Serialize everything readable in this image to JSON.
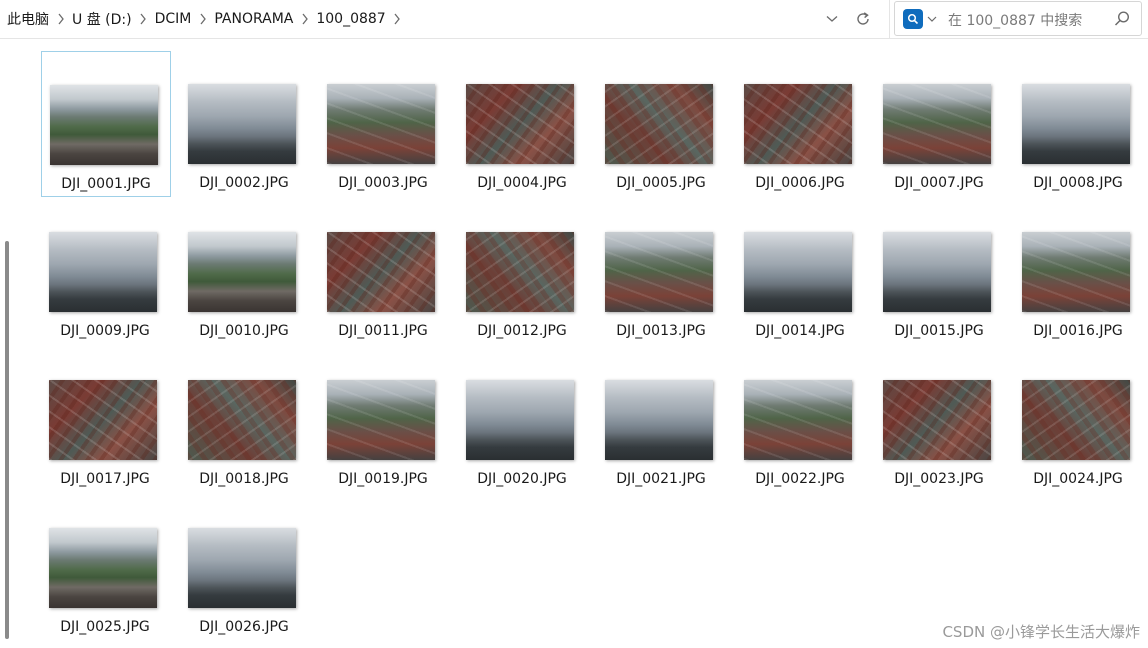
{
  "address": {
    "crumbs": [
      "此电脑",
      "U 盘 (D:)",
      "DCIM",
      "PANORAMA",
      "100_0887"
    ],
    "dropdown_icon": "chevron-down-icon",
    "refresh_icon": "refresh-icon"
  },
  "search": {
    "placeholder": "在 100_0887 中搜索",
    "scope_icon": "search-scope-icon",
    "icon": "search-icon"
  },
  "files": [
    {
      "name": "DJI_0001.JPG",
      "thumb": "field",
      "selected": true
    },
    {
      "name": "DJI_0002.JPG",
      "thumb": "sky"
    },
    {
      "name": "DJI_0003.JPG",
      "thumb": "mixed"
    },
    {
      "name": "DJI_0004.JPG",
      "thumb": "town"
    },
    {
      "name": "DJI_0005.JPG",
      "thumb": "town2"
    },
    {
      "name": "DJI_0006.JPG",
      "thumb": "town"
    },
    {
      "name": "DJI_0007.JPG",
      "thumb": "mixed"
    },
    {
      "name": "DJI_0008.JPG",
      "thumb": "sky"
    },
    {
      "name": "DJI_0009.JPG",
      "thumb": "sky"
    },
    {
      "name": "DJI_0010.JPG",
      "thumb": "field"
    },
    {
      "name": "DJI_0011.JPG",
      "thumb": "town"
    },
    {
      "name": "DJI_0012.JPG",
      "thumb": "town2"
    },
    {
      "name": "DJI_0013.JPG",
      "thumb": "mixed"
    },
    {
      "name": "DJI_0014.JPG",
      "thumb": "sky"
    },
    {
      "name": "DJI_0015.JPG",
      "thumb": "sky"
    },
    {
      "name": "DJI_0016.JPG",
      "thumb": "mixed"
    },
    {
      "name": "DJI_0017.JPG",
      "thumb": "town"
    },
    {
      "name": "DJI_0018.JPG",
      "thumb": "town2"
    },
    {
      "name": "DJI_0019.JPG",
      "thumb": "mixed"
    },
    {
      "name": "DJI_0020.JPG",
      "thumb": "sky"
    },
    {
      "name": "DJI_0021.JPG",
      "thumb": "sky"
    },
    {
      "name": "DJI_0022.JPG",
      "thumb": "mixed"
    },
    {
      "name": "DJI_0023.JPG",
      "thumb": "town"
    },
    {
      "name": "DJI_0024.JPG",
      "thumb": "town2"
    },
    {
      "name": "DJI_0025.JPG",
      "thumb": "field"
    },
    {
      "name": "DJI_0026.JPG",
      "thumb": "sky"
    }
  ],
  "watermark": "CSDN @小锋学长生活大爆炸",
  "colors": {
    "accent": "#0f6cbd",
    "selection_border": "#9fd0e8",
    "text": "#1a1a1a",
    "placeholder": "#7a7a7a"
  }
}
